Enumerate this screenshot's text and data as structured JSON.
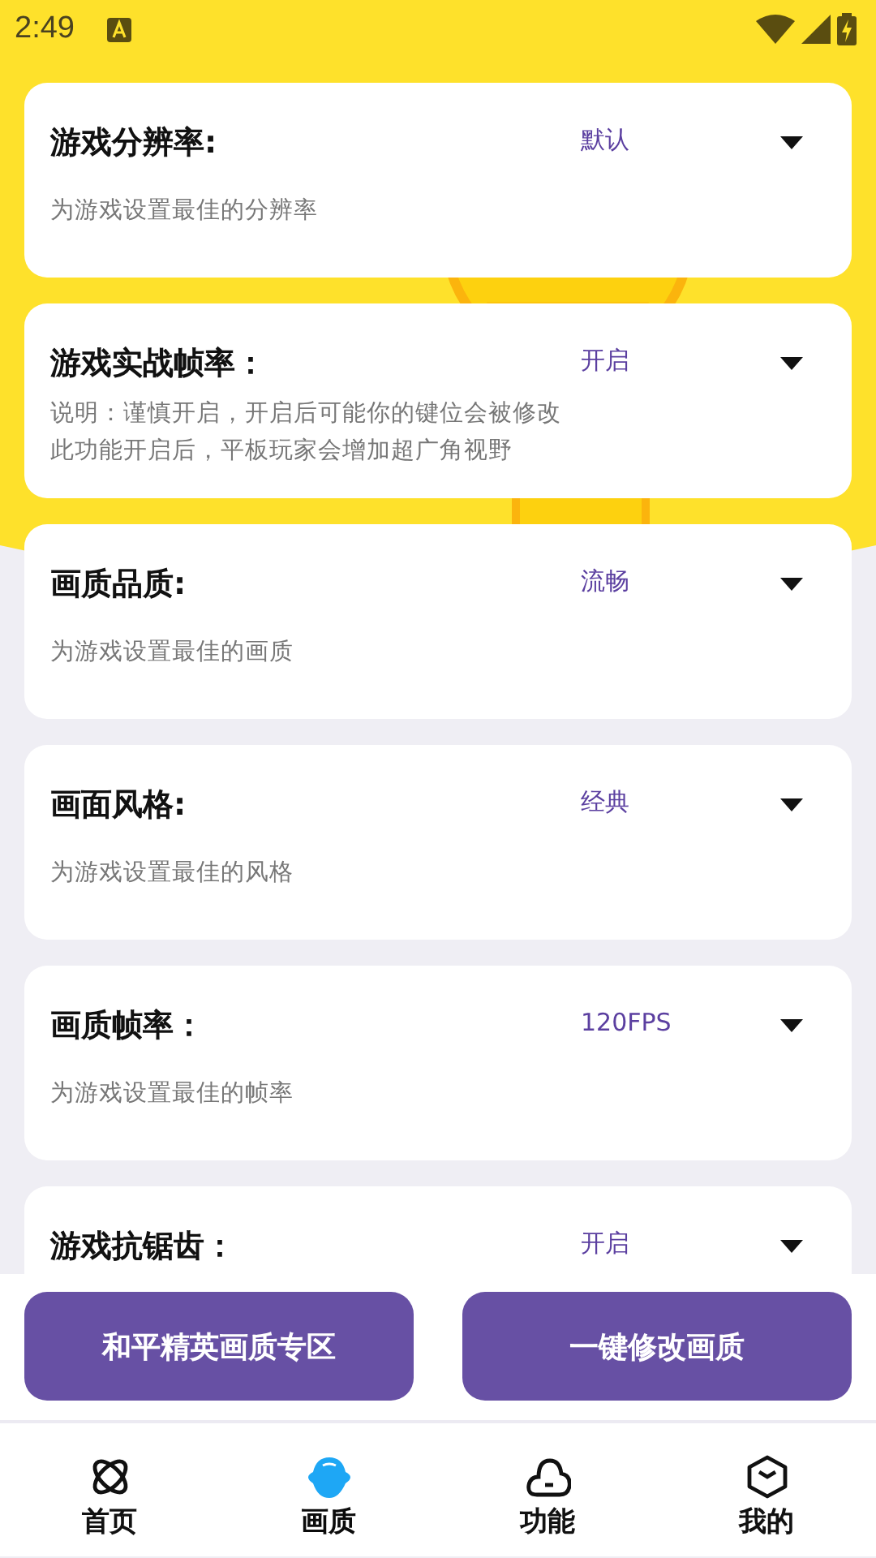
{
  "status_bar": {
    "time": "2:49"
  },
  "settings": [
    {
      "title": "游戏分辨率:",
      "value": "默认",
      "description": [
        "为游戏设置最佳的分辨率"
      ]
    },
    {
      "title": "游戏实战帧率：",
      "value": "开启",
      "description": [
        "说明：谨慎开启，开启后可能你的键位会被修改",
        "此功能开启后，平板玩家会增加超广角视野"
      ]
    },
    {
      "title": "画质品质:",
      "value": "流畅",
      "description": [
        "为游戏设置最佳的画质"
      ]
    },
    {
      "title": "画面风格:",
      "value": "经典",
      "description": [
        "为游戏设置最佳的风格"
      ]
    },
    {
      "title": "画质帧率：",
      "value": "120FPS",
      "description": [
        "为游戏设置最佳的帧率"
      ]
    },
    {
      "title": "游戏抗锯齿：",
      "value": "开启"
    }
  ],
  "buttons": [
    "和平精英画质专区",
    "一键修改画质"
  ],
  "nav": [
    {
      "label": "首页",
      "kind": "atom",
      "selected": false
    },
    {
      "label": "画质",
      "kind": "blob",
      "selected": true
    },
    {
      "label": "功能",
      "kind": "cloud",
      "selected": false
    },
    {
      "label": "我的",
      "kind": "hexagon",
      "selected": false
    }
  ]
}
